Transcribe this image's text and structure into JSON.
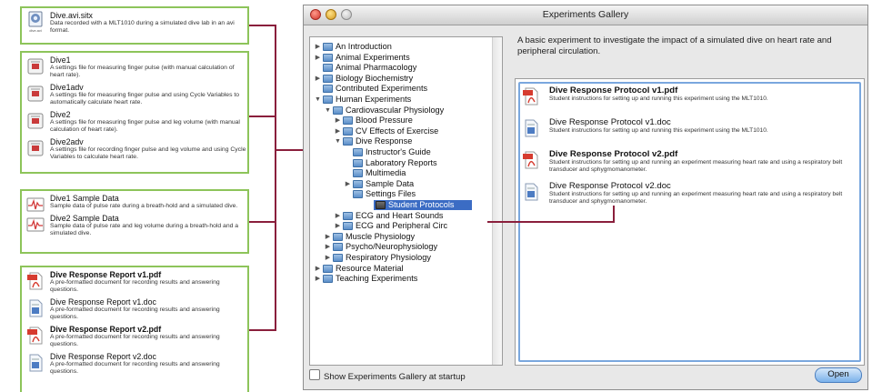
{
  "window": {
    "title": "Experiments Gallery"
  },
  "tree": {
    "items": [
      {
        "label": "An Introduction",
        "expanded": false
      },
      {
        "label": "Animal Experiments",
        "expanded": false
      },
      {
        "label": "Animal Pharmacology",
        "expanded": false
      },
      {
        "label": "Biology Biochemistry",
        "expanded": false
      },
      {
        "label": "Contributed Experiments",
        "expanded": false
      },
      {
        "label": "Human Experiments",
        "expanded": true
      },
      {
        "label": "Cardiovascular Physiology",
        "expanded": true
      },
      {
        "label": "Blood Pressure",
        "expanded": false
      },
      {
        "label": "CV Effects of Exercise",
        "expanded": false
      },
      {
        "label": "Dive Response",
        "expanded": true
      },
      {
        "label": "Instructor's Guide"
      },
      {
        "label": "Laboratory Reports"
      },
      {
        "label": "Multimedia"
      },
      {
        "label": "Sample Data",
        "expanded": false
      },
      {
        "label": "Settings Files"
      },
      {
        "label": "Student Protocols",
        "selected": true
      },
      {
        "label": "ECG and Heart Sounds",
        "expanded": false
      },
      {
        "label": "ECG and Peripheral Circ",
        "expanded": false
      },
      {
        "label": "Muscle Physiology",
        "expanded": false
      },
      {
        "label": "Psycho/Neurophysiology",
        "expanded": false
      },
      {
        "label": "Respiratory Physiology",
        "expanded": false
      },
      {
        "label": "Resource Material",
        "expanded": false
      },
      {
        "label": "Teaching Experiments",
        "expanded": false
      }
    ]
  },
  "description": "A basic experiment to investigate the impact of a simulated dive on heart rate and peripheral circulation.",
  "files": [
    {
      "name": "Dive Response Protocol v1.pdf",
      "desc": "Student instructions for setting up and running this experiment using the MLT1010.",
      "icon": "pdf-icon"
    },
    {
      "name": "Dive Response Protocol v1.doc",
      "desc": "Student instructions for setting up and running this experiment using the MLT1010.",
      "icon": "doc-icon"
    },
    {
      "name": "Dive Response Protocol v2.pdf",
      "desc": "Student instructions for setting up and running an experiment measuring heart rate and using a respiratory belt transducer and sphygmomanometer.",
      "icon": "pdf-icon"
    },
    {
      "name": "Dive Response Protocol v2.doc",
      "desc": "Student instructions for setting up and running an experiment measuring heart rate and using a respiratory belt transducer and sphygmomanometer.",
      "icon": "doc-icon"
    }
  ],
  "footer": {
    "startup_label": "Show Experiments Gallery at startup",
    "open_label": "Open"
  },
  "callouts": {
    "multimedia": {
      "name": "Dive.avi.sitx",
      "desc": "Data recorded with a MLT1010 during a simulated dive lab in an avi format.",
      "icon_caption": "dive.avi"
    },
    "settings": [
      {
        "name": "Dive1",
        "desc": "A settings file for measuring finger pulse (with manual calculation of heart rate)."
      },
      {
        "name": "Dive1adv",
        "desc": "A settings file for measuring finger pulse and using Cycle Variables to automatically calculate heart rate."
      },
      {
        "name": "Dive2",
        "desc": "A settings file for measuring finger pulse and leg volume (with manual calculation of heart rate)."
      },
      {
        "name": "Dive2adv",
        "desc": "A settings file for recording finger pulse and leg volume and using Cycle Variables to calculate heart rate."
      }
    ],
    "sample_data": [
      {
        "name": "Dive1 Sample Data",
        "desc": "Sample data of pulse rate during a breath-hold and a simulated dive."
      },
      {
        "name": "Dive2 Sample Data",
        "desc": "Sample data of pulse rate and leg volume during a breath-hold and a simulated dive."
      }
    ],
    "reports": [
      {
        "name": "Dive Response Report v1.pdf",
        "desc": "A pre-formatted document for recording results and answering questions.",
        "icon": "pdf-icon"
      },
      {
        "name": "Dive Response Report v1.doc",
        "desc": "A pre-formatted document for recording results and answering questions.",
        "icon": "doc-icon"
      },
      {
        "name": "Dive Response Report v2.pdf",
        "desc": "A pre-formatted document for recording results and answering questions.",
        "icon": "pdf-icon"
      },
      {
        "name": "Dive Response Report v2.doc",
        "desc": "A pre-formatted document for recording results and answering questions.",
        "icon": "doc-icon"
      }
    ]
  },
  "colors": {
    "callout_border": "#8dc45a",
    "connector": "#8a1f3c",
    "selection": "#3b6cc4",
    "accent": "#7aa7de"
  }
}
